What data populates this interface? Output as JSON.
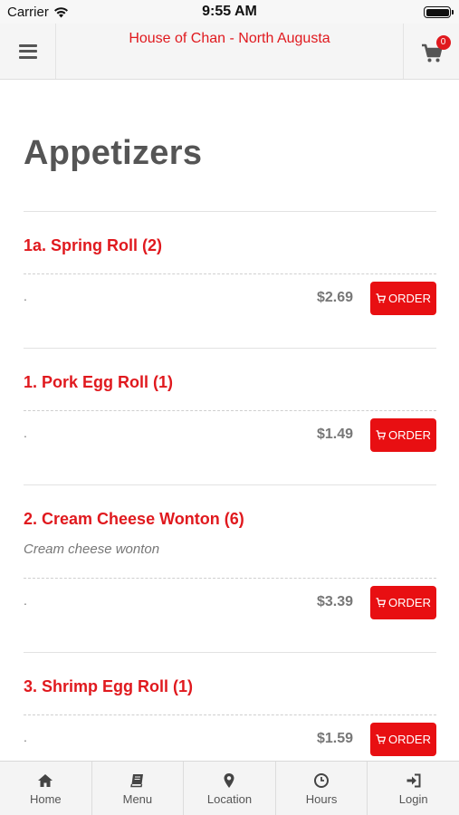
{
  "status_bar": {
    "carrier": "Carrier",
    "time": "9:55 AM"
  },
  "header": {
    "title": "House of Chan - North Augusta",
    "cart_count": "0"
  },
  "section": {
    "title": "Appetizers"
  },
  "order_label": "ORDER",
  "items": [
    {
      "name": "1a. Spring Roll (2)",
      "description": "",
      "detail": ".",
      "price": "$2.69"
    },
    {
      "name": "1. Pork Egg Roll (1)",
      "description": "",
      "detail": ".",
      "price": "$1.49"
    },
    {
      "name": "2. Cream Cheese Wonton (6)",
      "description": "Cream cheese wonton",
      "detail": ".",
      "price": "$3.39"
    },
    {
      "name": "3. Shrimp Egg Roll (1)",
      "description": "",
      "detail": ".",
      "price": "$1.59"
    }
  ],
  "tabs": [
    {
      "label": "Home",
      "icon": "home-icon"
    },
    {
      "label": "Menu",
      "icon": "book-icon"
    },
    {
      "label": "Location",
      "icon": "map-marker-icon"
    },
    {
      "label": "Hours",
      "icon": "clock-icon"
    },
    {
      "label": "Login",
      "icon": "sign-in-icon"
    }
  ],
  "colors": {
    "accent": "#e0191e",
    "button": "#e80f12",
    "text_muted": "#777777"
  }
}
